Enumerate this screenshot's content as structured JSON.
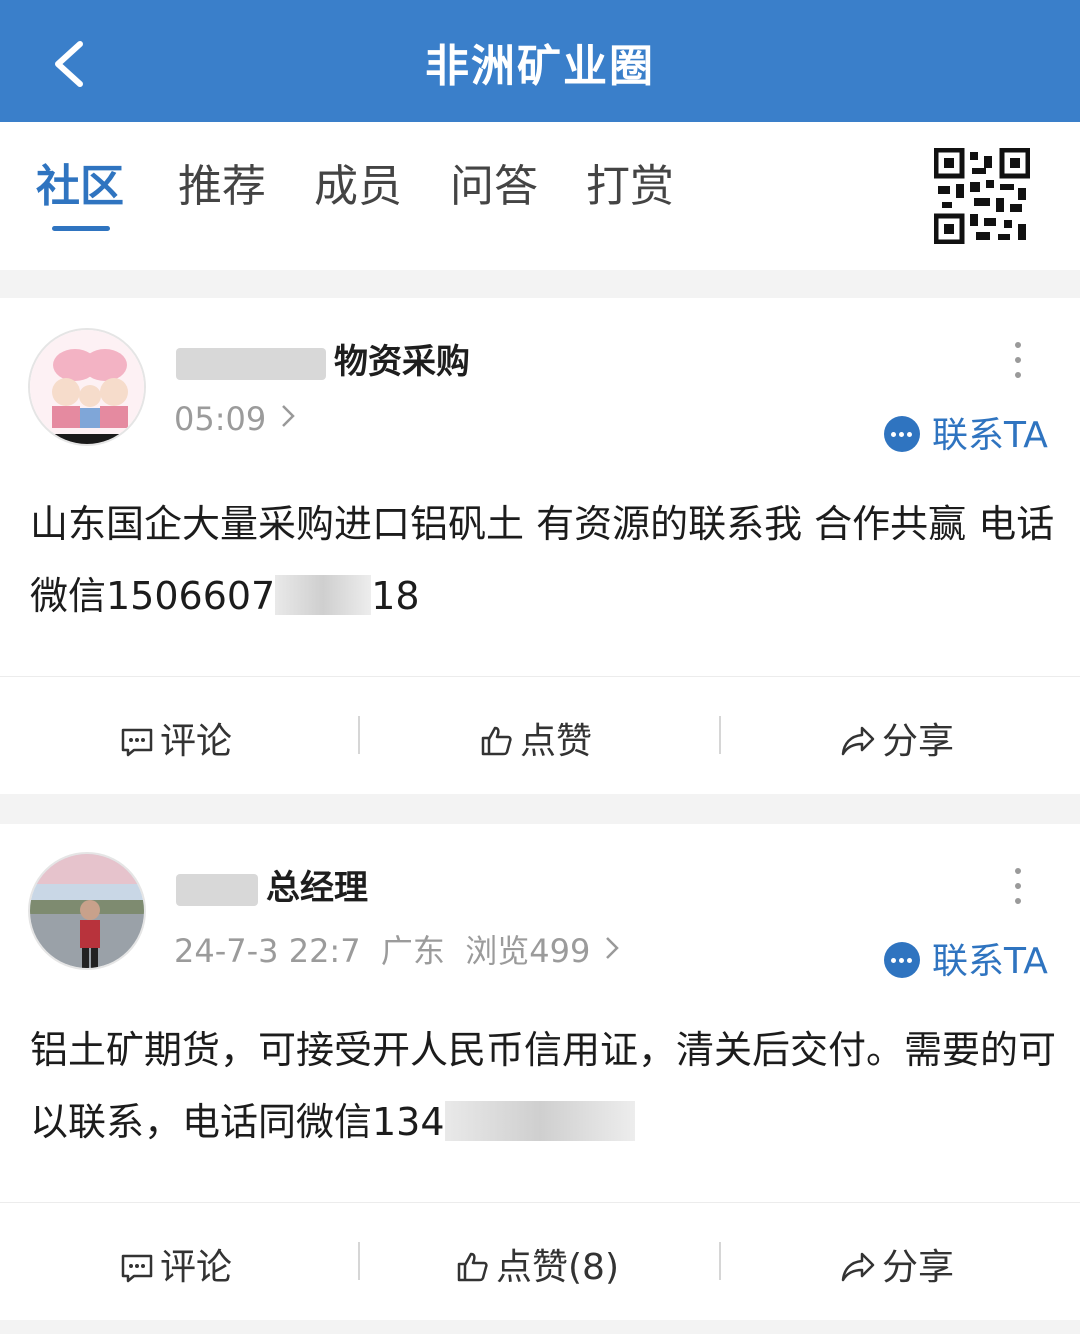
{
  "header": {
    "title": "非洲矿业圈",
    "background_color": "#3a7fca"
  },
  "tabs": [
    {
      "label": "社区",
      "active": true
    },
    {
      "label": "推荐",
      "active": false
    },
    {
      "label": "成员",
      "active": false
    },
    {
      "label": "问答",
      "active": false
    },
    {
      "label": "打赏",
      "active": false
    }
  ],
  "accent_color": "#2f74c0",
  "posts": [
    {
      "author_visible": "物资采购",
      "meta": "05:09",
      "contact_label": "联系TA",
      "text_part1": "山东国企大量采购进口铝矾土 有资源的联系我 合作共赢 电话 微信1506607",
      "text_part2": "18",
      "actions": {
        "comment": "评论",
        "like": "点赞",
        "share": "分享"
      }
    },
    {
      "author_visible": "总经理",
      "meta": "24-7-3 22:7  广东  浏览499",
      "contact_label": "联系TA",
      "text_part1": "铝土矿期货，可接受开人民币信用证，清关后交付。需要的可以联系，电话同微信134",
      "text_part2": "",
      "actions": {
        "comment": "评论",
        "like": "点赞(8)",
        "share": "分享"
      }
    }
  ],
  "icons": [
    "back-arrow-icon",
    "qr-code-icon",
    "more-vert-icon",
    "chat-bubble-icon",
    "comment-icon",
    "thumb-up-icon",
    "share-icon",
    "chevron-right-icon"
  ]
}
